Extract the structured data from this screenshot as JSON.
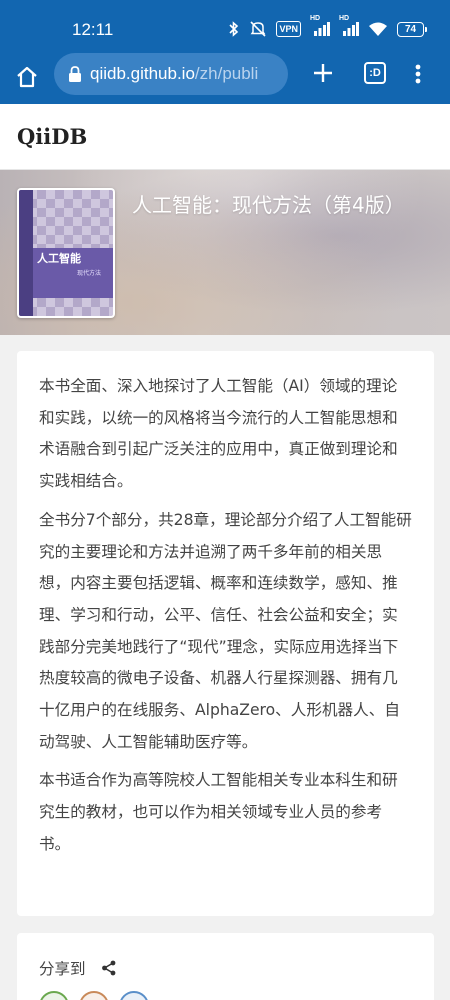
{
  "status_bar": {
    "time": "12:11",
    "vpn_label": "VPN",
    "signal_1_label": "HD",
    "signal_2_label": "HD",
    "battery": "74"
  },
  "browser": {
    "url_host": "qiidb.github.io",
    "url_path": "/zh/publi",
    "tabs_label": ":D"
  },
  "site": {
    "brand": "QiiDB"
  },
  "book": {
    "title": "人工智能：现代方法（第4版）",
    "cover_title": "人工智能",
    "cover_subtitle": "现代方法"
  },
  "description": {
    "paragraphs": [
      "本书全面、深入地探讨了人工智能（AI）领域的理论和实践，以统一的风格将当今流行的人工智能思想和术语融合到引起广泛关注的应用中，真正做到理论和实践相结合。",
      "全书分7个部分，共28章，理论部分介绍了人工智能研究的主要理论和方法并追溯了两千多年前的相关思想，内容主要包括逻辑、概率和连续数学，感知、推理、学习和行动，公平、信任、社会公益和安全；实践部分完美地践行了“现代”理念，实际应用选择当下热度较高的微电子设备、机器人行星探测器、拥有几十亿用户的在线服务、AlphaZero、人形机器人、自动驾驶、人工智能辅助医疗等。",
      "本书适合作为高等院校人工智能相关专业本科生和研究生的教材，也可以作为相关领域专业人员的参考书。"
    ]
  },
  "share": {
    "label": "分享到",
    "button_colors": [
      "#6aa84f",
      "#c98a5a",
      "#5a8fc9"
    ]
  },
  "colors": {
    "browser_chrome": "#1266b0",
    "url_box": "#3a82c5",
    "page_background": "#f1f1f1",
    "card_background": "#ffffff",
    "body_text": "#444444"
  },
  "icons": {
    "status": [
      "bluetooth-icon",
      "mute-icon",
      "vpn-icon",
      "signal-icon",
      "signal-icon",
      "wifi-icon",
      "battery-icon"
    ],
    "browser": [
      "home-icon",
      "lock-icon",
      "plus-icon",
      "tabs-icon",
      "more-vert-icon"
    ],
    "share": "share-icon"
  }
}
